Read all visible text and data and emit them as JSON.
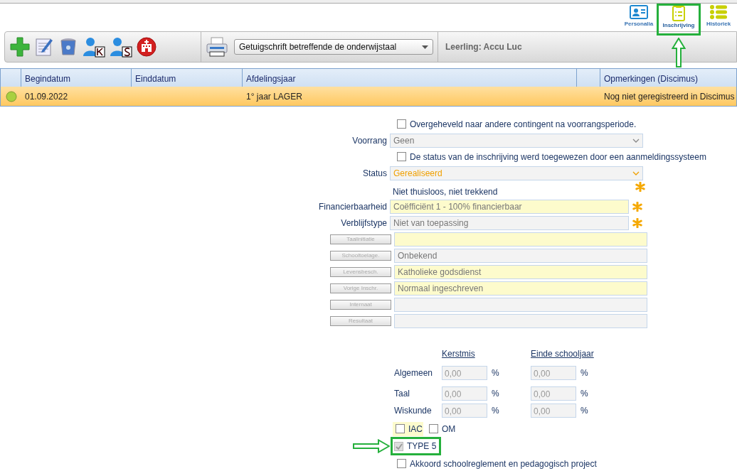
{
  "top_nav": [
    {
      "label": "Personalia",
      "kind": "card",
      "selected": false,
      "annotated": false
    },
    {
      "label": "Inschrijving",
      "kind": "clipboard",
      "selected": true,
      "annotated": true
    },
    {
      "label": "Historiek",
      "kind": "list",
      "selected": false,
      "annotated": false
    }
  ],
  "toolbar": {
    "report": "Getuigschrift betreffende de onderwijstaal",
    "student": "Leerling: Accu Luc"
  },
  "table": {
    "columns": [
      {
        "label": "Begindatum"
      },
      {
        "label": "Einddatum"
      },
      {
        "label": "Afdelingsjaar"
      },
      {
        "label": "Opmerkingen (Discimus)"
      }
    ],
    "rows": [
      {
        "begindatum": "01.09.2022",
        "afdelingsjaar": "1° jaar LAGER",
        "opmerkingen": "Nog niet geregistreerd in Discimus",
        "selected": true
      }
    ]
  },
  "form": [
    {
      "kind": "checkbox",
      "label": "Overgeheveld naar andere contingent na voorrangsperiode.",
      "checked": false
    },
    {
      "kind": "select",
      "label": "Voorrang",
      "value": "Geen",
      "emphasis": false
    },
    {
      "kind": "checkbox",
      "label": "De status van de inschrijving werd toegewezen door een aanmeldingssysteem",
      "checked": false
    },
    {
      "kind": "select",
      "label": "Status",
      "value": "Gerealiseerd",
      "emphasis": true
    },
    {
      "kind": "note",
      "text": "Niet thuisloos, niet trekkend",
      "required": true
    },
    {
      "kind": "field",
      "label": "Financierbaarheid",
      "value": "Coëfficiënt 1 - 100% financierbaar",
      "highlighted": true,
      "required": true
    },
    {
      "kind": "field",
      "label": "Verblijfstype",
      "value": "Niet van toepassing",
      "highlighted": false,
      "required": true
    },
    {
      "kind": "button-field",
      "button": "Taalinitiatie",
      "highlighted": true
    },
    {
      "kind": "button-field",
      "button": "Schooltoelage.",
      "value": "Onbekend",
      "highlighted": false
    },
    {
      "kind": "button-field",
      "button": "Levensbesch.",
      "value": "Katholieke godsdienst",
      "highlighted": true
    },
    {
      "kind": "button-field",
      "button": "Vorige Inschr.",
      "value": "Normaal ingeschreven",
      "highlighted": true
    },
    {
      "kind": "button-field",
      "button": "Internaat",
      "highlighted": false
    },
    {
      "kind": "button-field",
      "button": "Resultaat",
      "highlighted": false
    }
  ],
  "results": {
    "columns": [
      "Kerstmis",
      "Einde schooljaar"
    ],
    "rows": [
      {
        "label": "Algemeen",
        "cells": [
          {
            "value": "0,00",
            "unit": "%"
          },
          {
            "value": "0,00",
            "unit": "%"
          }
        ]
      },
      {
        "label": "Taal",
        "cells": [
          {
            "value": "0,00",
            "unit": "%"
          },
          {
            "value": "0,00",
            "unit": "%"
          }
        ]
      },
      {
        "label": "Wiskunde",
        "cells": [
          {
            "value": "0,00",
            "unit": "%"
          },
          {
            "value": "0,00",
            "unit": "%"
          }
        ]
      }
    ]
  },
  "options": [
    {
      "label": "IAC",
      "checked": false,
      "color": "#fdfbcc"
    },
    {
      "label": "OM",
      "checked": false
    }
  ],
  "type5": {
    "label": "TYPE 5",
    "checked": true,
    "disabled": true,
    "annotated": true
  },
  "agreement": {
    "label": "Akkoord schoolreglement en pedagogisch project",
    "checked": false
  }
}
